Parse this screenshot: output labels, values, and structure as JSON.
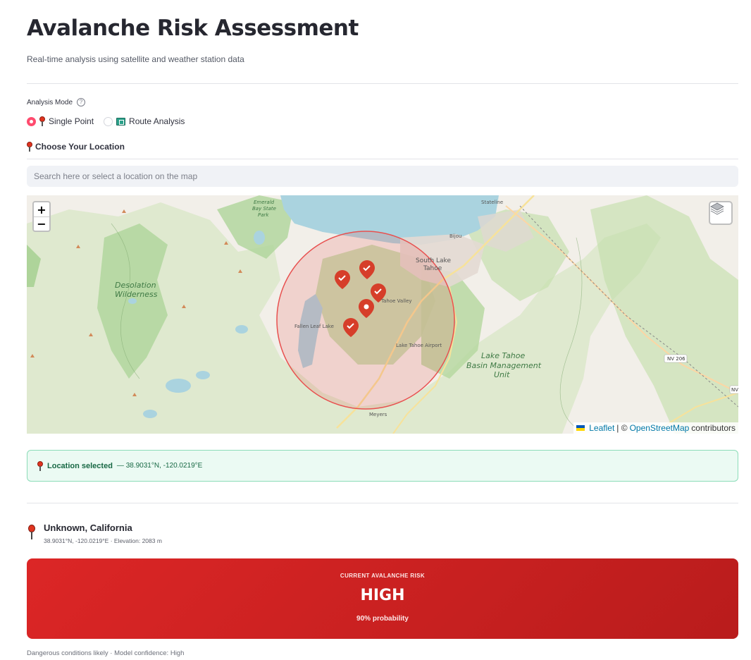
{
  "page": {
    "title": "Avalanche Risk Assessment",
    "subtitle": "Real-time analysis using satellite and weather station data"
  },
  "analysis_mode": {
    "label": "Analysis Mode",
    "help_icon": "question-circle-icon",
    "options": [
      {
        "label": "Single Point",
        "icon": "round-pushpin-icon",
        "selected": true
      },
      {
        "label": "Route Analysis",
        "icon": "map-icon",
        "selected": false
      }
    ]
  },
  "location_picker": {
    "label": "Choose Your Location",
    "search_placeholder": "Search here or select a location on the map"
  },
  "map": {
    "zoom_in": "+",
    "zoom_out": "−",
    "attribution": {
      "leaflet": "Leaflet",
      "separator": "| ©",
      "osm": "OpenStreetMap",
      "suffix": "contributors"
    },
    "labels": {
      "desolation": "Desolation",
      "wilderness": "Wilderness",
      "emerald_bay": "Emerald",
      "emerald_bay2": "Bay State",
      "emerald_bay3": "Park",
      "south_lake": "South Lake",
      "tahoe": "Tahoe",
      "stateline": "Stateline",
      "bijou": "Bijou",
      "valley": "Tahoe Valley",
      "basin1": "Lake Tahoe",
      "basin2": "Basin Management",
      "basin3": "Unit",
      "meyers": "Meyers",
      "airport": "Lake Tahoe Airport",
      "fallen_leaf": "Fallen Leaf Lake",
      "nv206": "NV 206",
      "nv": "NV"
    },
    "circle_color": "#e8504f"
  },
  "success_alert": {
    "title": "Location selected",
    "coords": "— 38.9031°N, -120.0219°E"
  },
  "result": {
    "location_name": "Unknown, California",
    "meta": "38.9031°N, -120.0219°E · Elevation: 2083 m",
    "risk_eyebrow": "CURRENT AVALANCHE RISK",
    "risk_level": "HIGH",
    "probability": "90% probability",
    "footnote": "Dangerous conditions likely · Model confidence: High",
    "risk_color": "#dc2626"
  }
}
